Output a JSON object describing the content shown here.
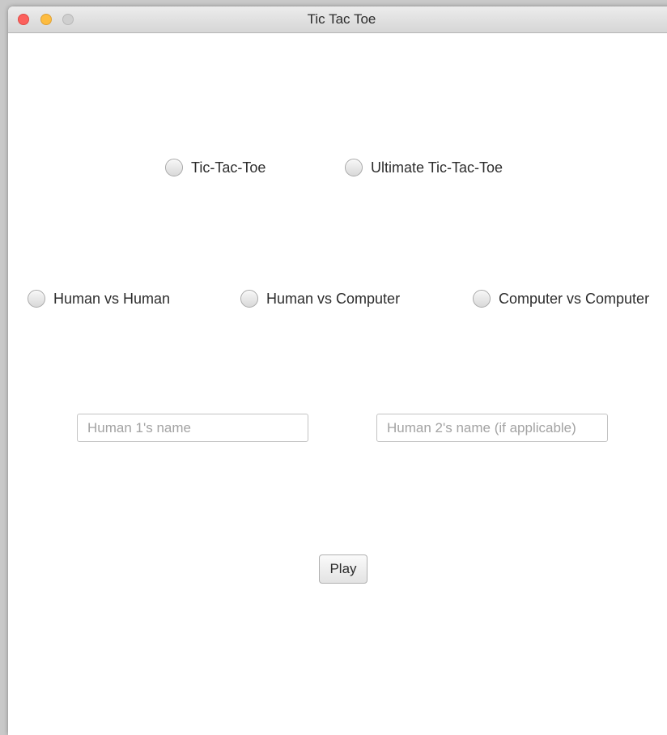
{
  "window": {
    "title": "Tic Tac Toe"
  },
  "game_type": {
    "options": [
      {
        "label": "Tic-Tac-Toe",
        "selected": false
      },
      {
        "label": "Ultimate Tic-Tac-Toe",
        "selected": false
      }
    ]
  },
  "mode": {
    "options": [
      {
        "label": "Human vs Human",
        "selected": false
      },
      {
        "label": "Human vs Computer",
        "selected": false
      },
      {
        "label": "Computer vs Computer",
        "selected": false
      }
    ]
  },
  "players": {
    "player1": {
      "value": "",
      "placeholder": "Human 1's name"
    },
    "player2": {
      "value": "",
      "placeholder": "Human 2's name (if applicable)"
    }
  },
  "actions": {
    "play_label": "Play"
  }
}
